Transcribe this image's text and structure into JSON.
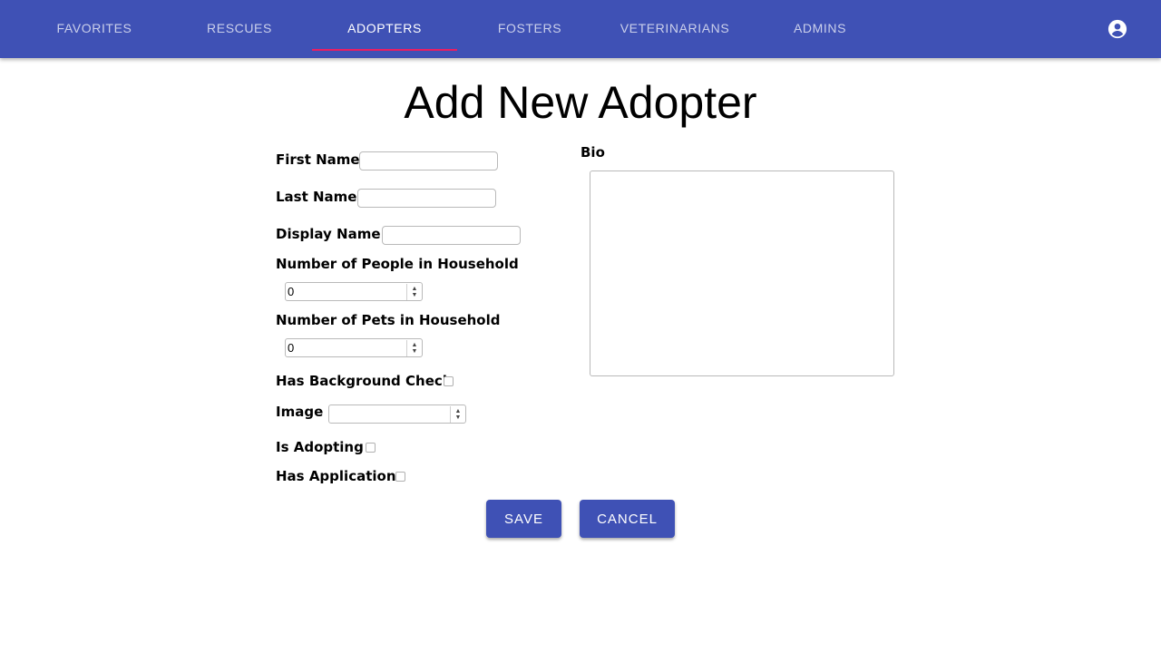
{
  "nav": {
    "tabs": [
      {
        "label": "FAVORITES"
      },
      {
        "label": "RESCUES"
      },
      {
        "label": "ADOPTERS"
      },
      {
        "label": "FOSTERS"
      },
      {
        "label": "VETERINARIANS"
      },
      {
        "label": "ADMINS"
      }
    ],
    "active_tab": "ADOPTERS",
    "account_icon": "account-circle-icon"
  },
  "page": {
    "title": "Add New Adopter"
  },
  "form": {
    "first_name": {
      "label": "First Name",
      "value": ""
    },
    "last_name": {
      "label": "Last Name",
      "value": ""
    },
    "display_name": {
      "label": "Display Name",
      "value": ""
    },
    "people_in_household": {
      "label": "Number of People in Household",
      "value": "0"
    },
    "pets_in_household": {
      "label": "Number of Pets in Household",
      "value": "0"
    },
    "has_background_check": {
      "label": "Has Background Check",
      "checked": false
    },
    "image": {
      "label": "Image",
      "value": ""
    },
    "is_adopting": {
      "label": "Is Adopting",
      "checked": false
    },
    "has_application": {
      "label": "Has Application",
      "checked": false
    },
    "bio": {
      "label": "Bio",
      "value": ""
    }
  },
  "buttons": {
    "save": "SAVE",
    "cancel": "CANCEL"
  },
  "colors": {
    "primary": "#3f51b5",
    "tab_indicator": "#e91e63"
  }
}
